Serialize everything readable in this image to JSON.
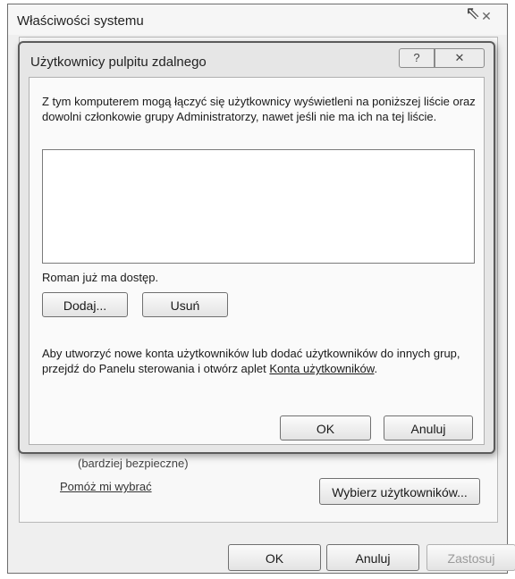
{
  "outer_window": {
    "title": "Właściwości systemu",
    "close_icon": "close-icon",
    "partial_text": "(bardziej bezpieczne)",
    "help_link": "Pomóż mi wybrać",
    "select_users_button": "Wybierz użytkowników...",
    "ok_button": "OK",
    "cancel_button": "Anuluj",
    "apply_button": "Zastosuj"
  },
  "dialog": {
    "title": "Użytkownicy pulpitu zdalnego",
    "help_icon": "help-icon",
    "close_icon": "close-icon",
    "intro_text": "Z tym komputerem mogą łączyć się użytkownicy wyświetleni na poniższej liście oraz dowolni członkowie grupy Administratorzy, nawet jeśli nie ma ich na tej liście.",
    "users": [],
    "access_text": "Roman już ma dostęp.",
    "add_button": "Dodaj...",
    "remove_button": "Usuń",
    "create_text": "Aby utworzyć nowe konta użytkowników lub dodać użytkowników do innych grup, przejdź do Panelu sterowania i otwórz aplet ",
    "create_link": "Konta użytkowników",
    "create_text_end": ".",
    "ok_button": "OK",
    "cancel_button": "Anuluj"
  }
}
